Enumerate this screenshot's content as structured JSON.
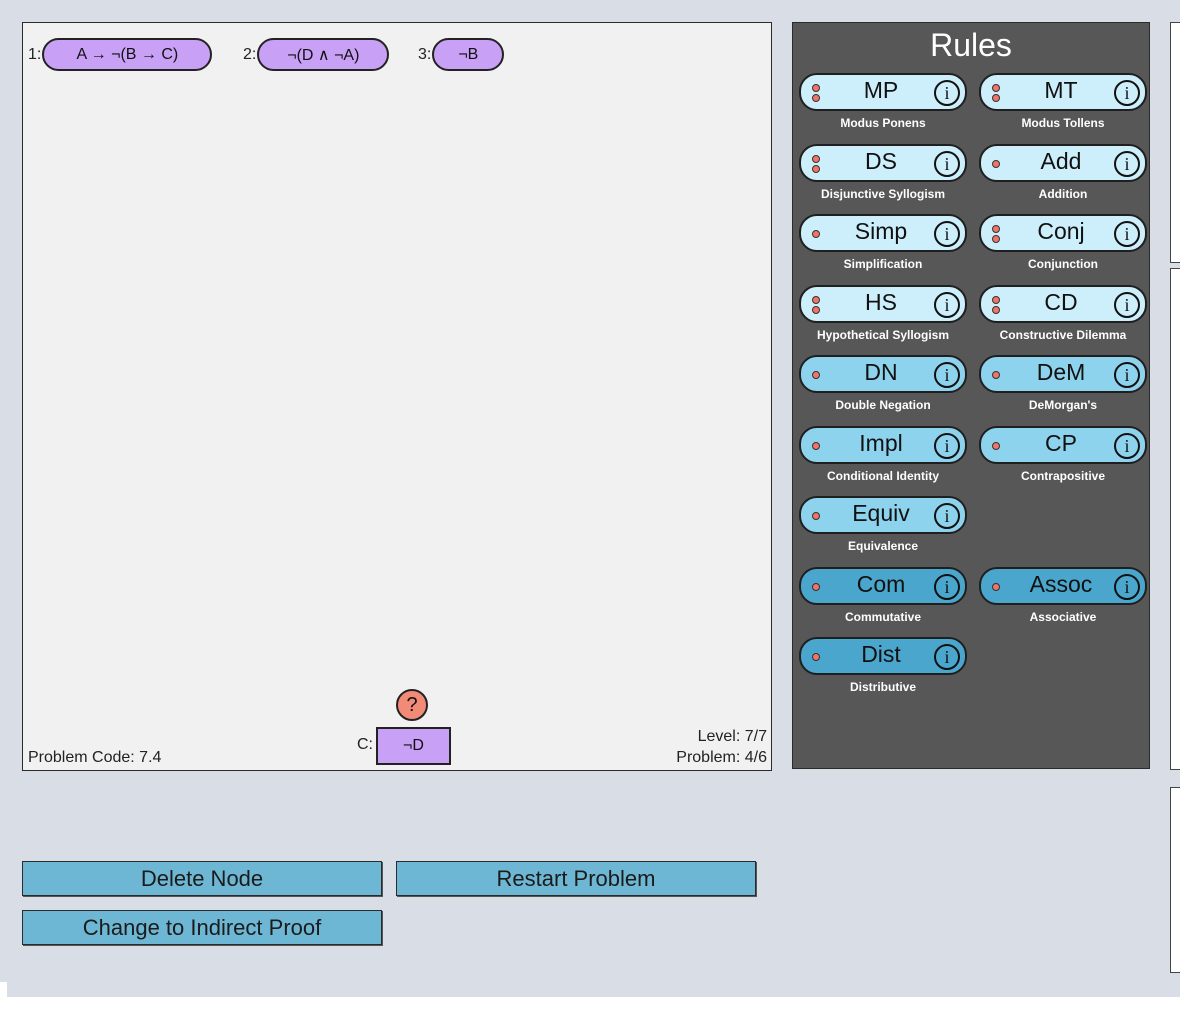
{
  "canvas": {
    "premises": [
      {
        "number": "1:",
        "formula": "A → ¬(B → C)"
      },
      {
        "number": "2:",
        "formula": "¬(D ∧ ¬A)"
      },
      {
        "number": "3:",
        "formula": "¬B"
      }
    ],
    "goal": {
      "icon": "question-mark-icon",
      "icon_text": "?",
      "label": "C:",
      "formula": "¬D"
    },
    "problem_code": "Problem Code: 7.4",
    "level": "Level: 7/7",
    "problem": "Problem: 4/6"
  },
  "rules_panel": {
    "title": "Rules",
    "info_glyph": "i",
    "rules": [
      {
        "abbr": "MP",
        "name": "Modus Ponens",
        "inputs": 2,
        "color": "#cdeefb"
      },
      {
        "abbr": "MT",
        "name": "Modus Tollens",
        "inputs": 2,
        "color": "#cdeefb"
      },
      {
        "abbr": "DS",
        "name": "Disjunctive Syllogism",
        "inputs": 2,
        "color": "#cdeefb"
      },
      {
        "abbr": "Add",
        "name": "Addition",
        "inputs": 1,
        "color": "#cdeefb"
      },
      {
        "abbr": "Simp",
        "name": "Simplification",
        "inputs": 1,
        "color": "#cdeefb"
      },
      {
        "abbr": "Conj",
        "name": "Conjunction",
        "inputs": 2,
        "color": "#cdeefb"
      },
      {
        "abbr": "HS",
        "name": "Hypothetical Syllogism",
        "inputs": 2,
        "color": "#cdeefb"
      },
      {
        "abbr": "CD",
        "name": "Constructive Dilemma",
        "inputs": 2,
        "color": "#cdeefb"
      },
      {
        "abbr": "DN",
        "name": "Double Negation",
        "inputs": 1,
        "color": "#8ed3ee"
      },
      {
        "abbr": "DeM",
        "name": "DeMorgan's",
        "inputs": 1,
        "color": "#8ed3ee"
      },
      {
        "abbr": "Impl",
        "name": "Conditional Identity",
        "inputs": 1,
        "color": "#8ed3ee"
      },
      {
        "abbr": "CP",
        "name": "Contrapositive",
        "inputs": 1,
        "color": "#8ed3ee"
      },
      {
        "abbr": "Equiv",
        "name": "Equivalence",
        "inputs": 1,
        "color": "#8ed3ee"
      },
      {
        "abbr": "Com",
        "name": "Commutative",
        "inputs": 1,
        "color": "#4aa6cc"
      },
      {
        "abbr": "Assoc",
        "name": "Associative",
        "inputs": 1,
        "color": "#4aa6cc"
      },
      {
        "abbr": "Dist",
        "name": "Distributive",
        "inputs": 1,
        "color": "#4aa6cc"
      }
    ]
  },
  "buttons": {
    "delete_node": "Delete Node",
    "restart_problem": "Restart Problem",
    "indirect_proof": "Change to Indirect Proof"
  }
}
